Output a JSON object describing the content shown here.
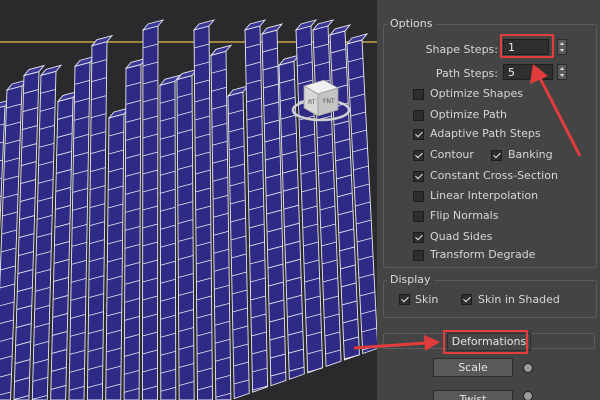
{
  "options": {
    "title": "Options",
    "shape_steps": {
      "label": "Shape Steps:",
      "value": "1"
    },
    "path_steps": {
      "label": "Path Steps:",
      "value": "5"
    },
    "checkboxes": [
      {
        "label": "Optimize Shapes",
        "checked": false
      },
      {
        "label": "Optimize Path",
        "checked": false
      },
      {
        "label": "Adaptive Path Steps",
        "checked": true
      },
      {
        "label": "Contour",
        "checked": true
      },
      {
        "label": "Banking",
        "checked": true
      },
      {
        "label": "Constant Cross-Section",
        "checked": true
      },
      {
        "label": "Linear Interpolation",
        "checked": false
      },
      {
        "label": "Flip Normals",
        "checked": false
      },
      {
        "label": "Quad Sides",
        "checked": true
      },
      {
        "label": "Transform Degrade",
        "checked": false
      }
    ]
  },
  "display": {
    "title": "Display",
    "skin": {
      "label": "Skin",
      "checked": true
    },
    "skin_in_shaded": {
      "label": "Skin in Shaded",
      "checked": true
    }
  },
  "deformations": {
    "title": "Deformations",
    "buttons": [
      {
        "label": "Scale"
      },
      {
        "label": "Twist"
      }
    ]
  },
  "colors": {
    "mesh_fill": "#2e2a86",
    "wire": "#e8e8f2",
    "highlight_red": "#e23c3c"
  }
}
